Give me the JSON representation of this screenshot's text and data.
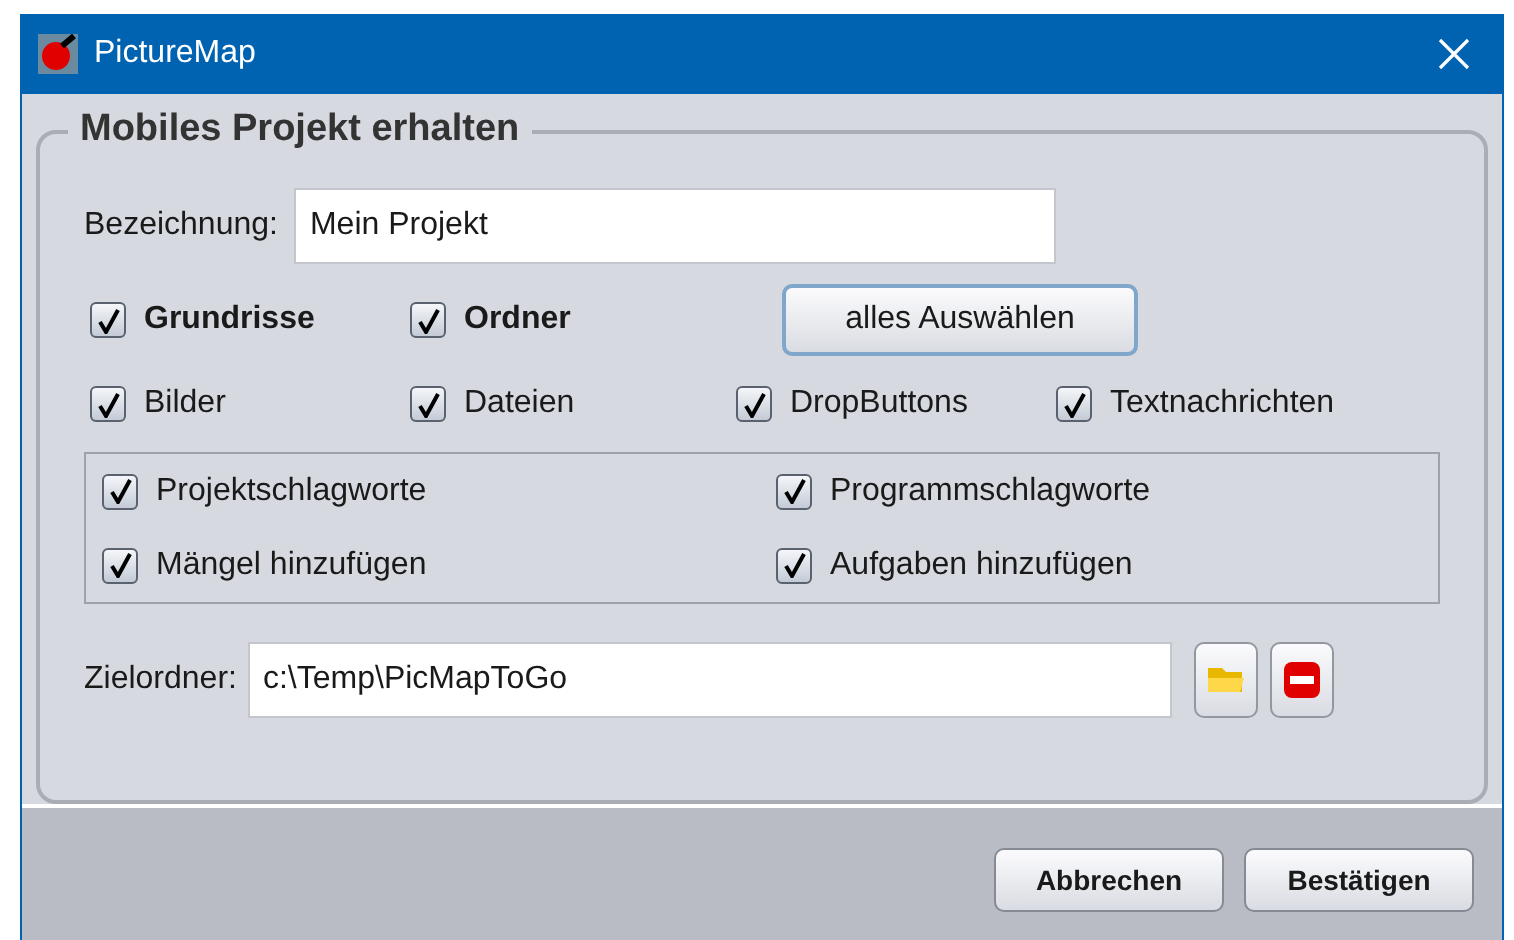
{
  "window": {
    "title": "PictureMap"
  },
  "group": {
    "title": "Mobiles Projekt erhalten"
  },
  "name_field": {
    "label": "Bezeichnung:",
    "value": "Mein Projekt"
  },
  "main_options": [
    {
      "label": "Grundrisse",
      "checked": true
    },
    {
      "label": "Ordner",
      "checked": true
    }
  ],
  "select_all_button": "alles Auswählen",
  "content_options": [
    {
      "label": "Bilder",
      "checked": true
    },
    {
      "label": "Dateien",
      "checked": true
    },
    {
      "label": "DropButtons",
      "checked": true
    },
    {
      "label": "Textnachrichten",
      "checked": true
    }
  ],
  "extra_options": [
    {
      "label": "Projektschlagworte",
      "checked": true
    },
    {
      "label": "Programmschlagworte",
      "checked": true
    },
    {
      "label": "Mängel hinzufügen",
      "checked": true
    },
    {
      "label": "Aufgaben hinzufügen",
      "checked": true
    }
  ],
  "target_field": {
    "label": "Zielordner:",
    "value": "c:\\Temp\\PicMapToGo"
  },
  "buttons": [
    "Abbrechen",
    "Bestätigen"
  ]
}
